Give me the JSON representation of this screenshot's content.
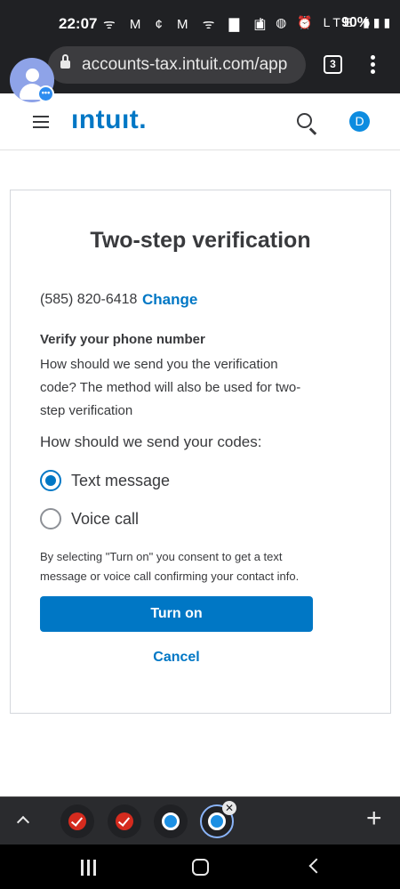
{
  "status_bar": {
    "time": "22:07",
    "left_icons": "ᯤ M ¢ M ᯤ ▇ ▣",
    "right_icons": "⚷ ◍ ⏰ LTE ▮▮▮",
    "battery": "90%"
  },
  "browser": {
    "url": "accounts-tax.intuit.com/app",
    "tab_count": "3",
    "chat_badge": "•••"
  },
  "header": {
    "logo": "ıntuıt.",
    "user_initial": "D"
  },
  "card": {
    "title": "Two-step verification",
    "phone": "(585) 820-6418",
    "change_label": "Change",
    "verify_heading": "Verify your phone number",
    "verify_desc": "How should we send you the verification code? The method will also be used for two-step verification",
    "codes_question": "How should we send your codes:",
    "options": [
      {
        "label": "Text message",
        "selected": true
      },
      {
        "label": "Voice call",
        "selected": false
      }
    ],
    "consent": "By selecting \"Turn on\" you consent to get a text message or voice call confirming your contact info.",
    "turn_on_label": "Turn on",
    "cancel_label": "Cancel"
  },
  "tab_strip": {
    "close_glyph": "✕",
    "plus_glyph": "+"
  },
  "colors": {
    "accent": "#0077c5",
    "text": "#393a3d",
    "browser_chrome": "#202124"
  }
}
